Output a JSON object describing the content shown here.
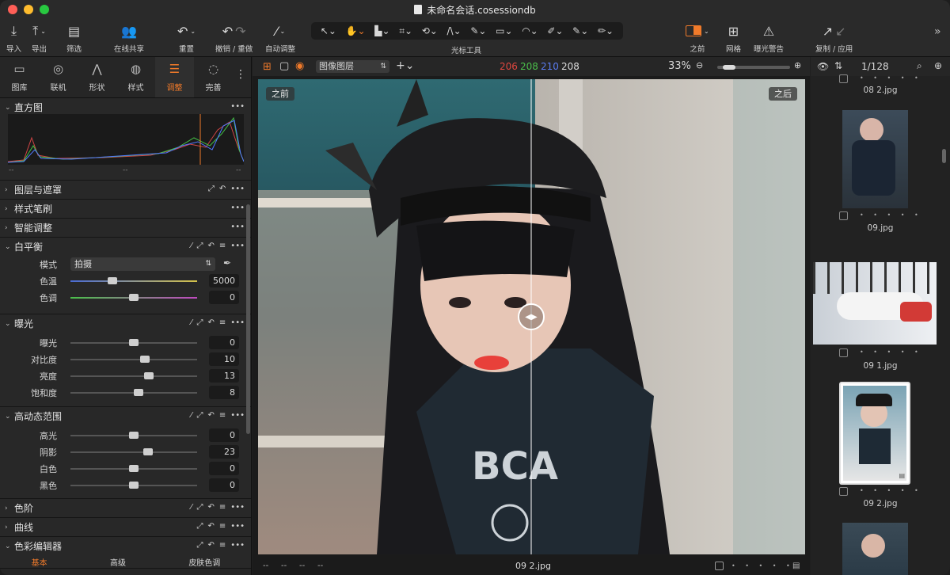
{
  "window": {
    "title": "未命名会话.cosessiondb"
  },
  "toolbar": {
    "import": "导入",
    "export": "导出",
    "filter": "筛选",
    "share": "在线共享",
    "reset": "重置",
    "undo_redo": "撤销 / 重做",
    "auto_adjust": "自动调整",
    "cursor_tools": "光标工具",
    "before": "之前",
    "grid": "网格",
    "exposure_warning": "曝光警告",
    "copy_apply": "复制 / 应用"
  },
  "tool_tabs": [
    {
      "label": "图库",
      "icon": "folder-icon"
    },
    {
      "label": "联机",
      "icon": "camera-icon"
    },
    {
      "label": "形状",
      "icon": "shape-icon"
    },
    {
      "label": "样式",
      "icon": "style-icon"
    },
    {
      "label": "调整",
      "icon": "sliders-icon",
      "active": true
    },
    {
      "label": "完善",
      "icon": "refine-icon"
    }
  ],
  "sections": {
    "histogram": "直方图",
    "histogram_footer": [
      "--",
      "--",
      "--"
    ],
    "layers": "图层与遮罩",
    "style_brush": "样式笔刷",
    "smart_adjust": "智能调整",
    "white_balance": "白平衡",
    "exposure": "曝光",
    "hdr": "高动态范围",
    "levels": "色阶",
    "curves": "曲线",
    "color_editor": "色彩编辑器"
  },
  "white_balance": {
    "mode_label": "模式",
    "mode_value": "拍摄",
    "temp_label": "色温",
    "temp_value": "5000",
    "temp_pos": 0.33,
    "tint_label": "色调",
    "tint_value": "0",
    "tint_pos": 0.5
  },
  "exposure": [
    {
      "label": "曝光",
      "value": "0",
      "pos": 0.5
    },
    {
      "label": "对比度",
      "value": "10",
      "pos": 0.59
    },
    {
      "label": "亮度",
      "value": "13",
      "pos": 0.62
    },
    {
      "label": "饱和度",
      "value": "8",
      "pos": 0.54
    }
  ],
  "hdr": [
    {
      "label": "高光",
      "value": "0",
      "pos": 0.5
    },
    {
      "label": "阴影",
      "value": "23",
      "pos": 0.61
    },
    {
      "label": "白色",
      "value": "0",
      "pos": 0.5
    },
    {
      "label": "黑色",
      "value": "0",
      "pos": 0.5
    }
  ],
  "color_editor_tabs": [
    "基本",
    "高级",
    "皮肤色调"
  ],
  "viewer": {
    "layer_select": "图像图层",
    "rgb": {
      "r": "206",
      "g": "208",
      "b": "210",
      "l": "208"
    },
    "zoom": "33%",
    "zoom_slider_pos": 0.08,
    "before_label": "之前",
    "after_label": "之后",
    "footer_dashes": [
      "--",
      "--",
      "--",
      "--"
    ],
    "filename": "09 2.jpg"
  },
  "browser": {
    "count": "1/128",
    "items": [
      {
        "caption": "08 2.jpg"
      },
      {
        "caption": "09.jpg"
      },
      {
        "caption": "09 1.jpg"
      },
      {
        "caption": "09 2.jpg",
        "selected": true
      }
    ]
  },
  "colors": {
    "accent": "#f07a2a",
    "red": "#e0473f",
    "green": "#4bbf4b",
    "blue": "#5a7cf0"
  }
}
